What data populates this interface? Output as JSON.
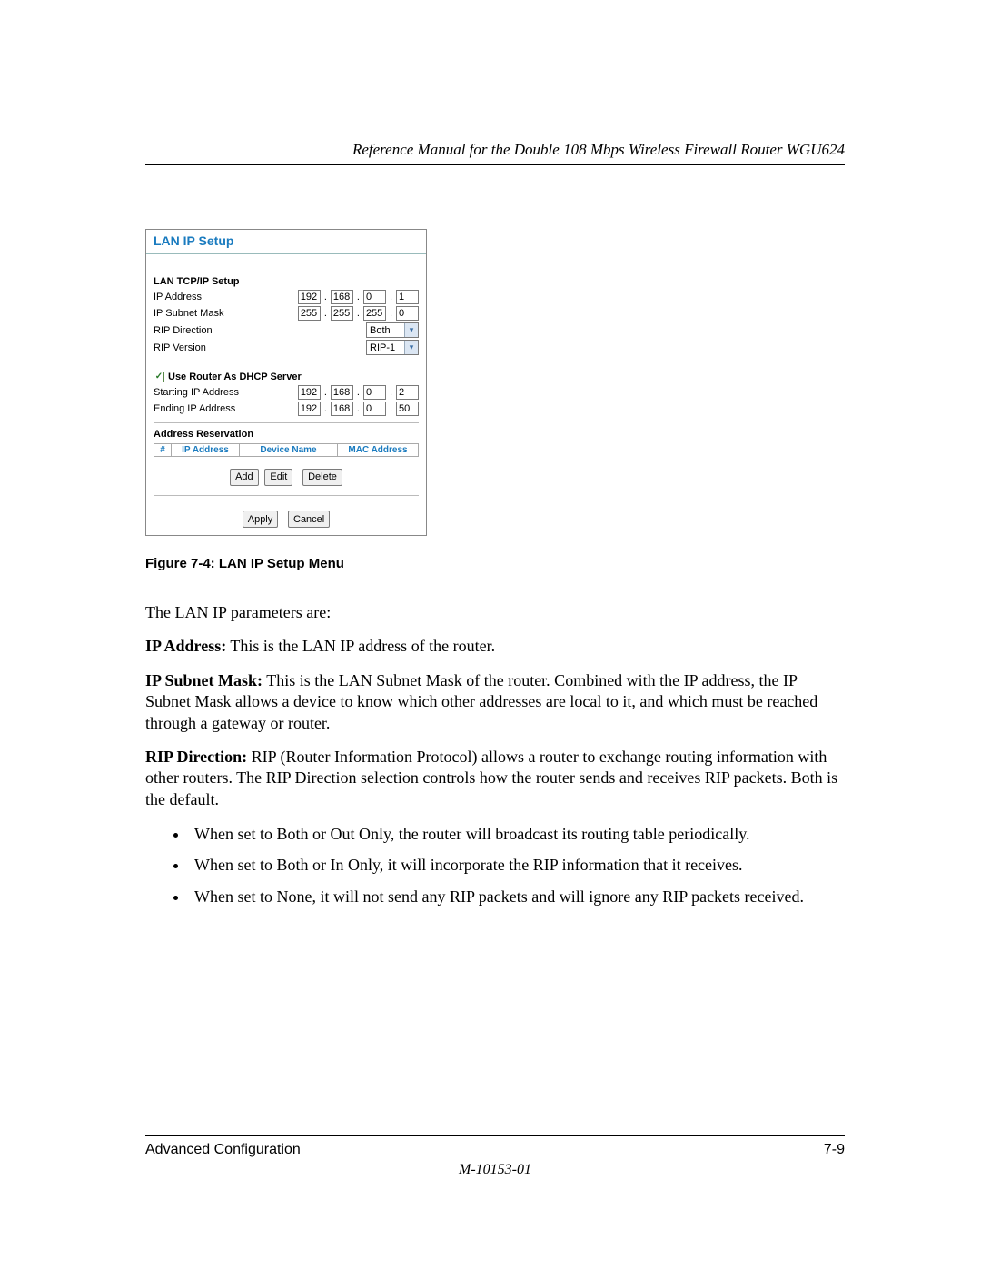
{
  "header": {
    "title": "Reference Manual for the Double 108 Mbps Wireless Firewall Router WGU624"
  },
  "figure": {
    "title": "LAN IP Setup",
    "section_tcpip": "LAN TCP/IP Setup",
    "ip_address_label": "IP Address",
    "ip_address": [
      "192",
      "168",
      "0",
      "1"
    ],
    "subnet_label": "IP Subnet Mask",
    "subnet": [
      "255",
      "255",
      "255",
      "0"
    ],
    "rip_dir_label": "RIP Direction",
    "rip_dir_value": "Both",
    "rip_ver_label": "RIP Version",
    "rip_ver_value": "RIP-1",
    "dhcp_checkbox_label": "Use Router As DHCP Server",
    "dhcp_checked": "✓",
    "start_ip_label": "Starting IP Address",
    "start_ip": [
      "192",
      "168",
      "0",
      "2"
    ],
    "end_ip_label": "Ending IP Address",
    "end_ip": [
      "192",
      "168",
      "0",
      "50"
    ],
    "reservation_heading": "Address Reservation",
    "col_num": "#",
    "col_ip": "IP Address",
    "col_dev": "Device Name",
    "col_mac": "MAC Address",
    "btn_add": "Add",
    "btn_edit": "Edit",
    "btn_delete": "Delete",
    "btn_apply": "Apply",
    "btn_cancel": "Cancel",
    "caption": "Figure 7-4:  LAN IP Setup Menu"
  },
  "text": {
    "intro": "The LAN IP parameters are:",
    "ip_addr_b": "IP Address:",
    "ip_addr_t": " This is the LAN IP address of the router.",
    "subnet_b": "IP Subnet Mask:",
    "subnet_t": " This is the LAN Subnet Mask of the router. Combined with the IP address, the IP Subnet Mask allows a device to know which other addresses are local to it, and which must be reached through a gateway or router.",
    "rip_b": "RIP Direction:",
    "rip_t": " RIP (Router Information Protocol) allows a router to exchange routing information with other routers. The RIP Direction selection controls how the router sends and receives RIP packets. Both is the default.",
    "bullets": [
      "When set to Both or Out Only, the router will broadcast its routing table periodically.",
      "When set to Both or In Only, it will incorporate the RIP information that it receives.",
      "When set to None, it will not send any RIP packets and will ignore any RIP packets received."
    ]
  },
  "footer": {
    "left": "Advanced Configuration",
    "right": "7-9",
    "code": "M-10153-01"
  }
}
